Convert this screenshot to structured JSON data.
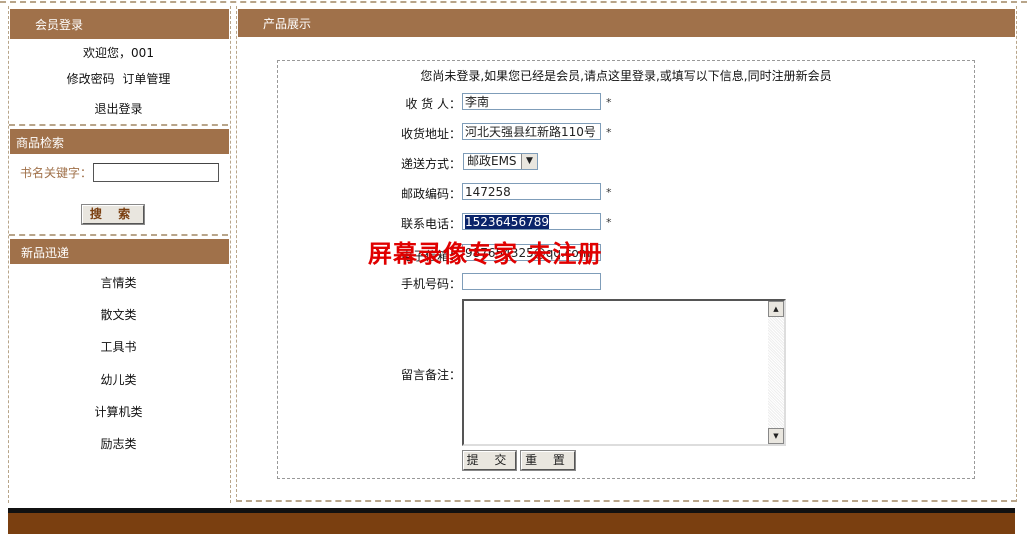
{
  "sidebar": {
    "member": {
      "header": "会员登录",
      "welcome": "欢迎您，001",
      "change_password": "修改密码",
      "orders": "订单管理",
      "logout": "退出登录"
    },
    "search": {
      "header": "商品检索",
      "keyword_label": "书名关键字：",
      "keyword_value": "",
      "button": "搜 索"
    },
    "new_books": {
      "header": "新品迅递",
      "items": [
        "言情类",
        "散文类",
        "工具书",
        "幼儿类",
        "计算机类",
        "励志类"
      ]
    }
  },
  "main": {
    "header": "产品展示",
    "notice": "您尚未登录,如果您已经是会员,请点这里登录,或填写以下信息,同时注册新会员",
    "form": {
      "receiver_label": "收 货 人：",
      "receiver_value": "李南",
      "address_label": "收货地址：",
      "address_value": "河北天强县红新路110号",
      "delivery_label": "递送方式：",
      "delivery_value": "邮政EMS",
      "postcode_label": "邮政编码：",
      "postcode_value": "147258",
      "phone_label": "联系电话：",
      "phone_value": "15236456789",
      "email_label": "电子信箱：",
      "email_value": "987654325@qq.com",
      "mobile_label": "手机号码：",
      "mobile_value": "",
      "remark_label": "留言备注：",
      "remark_value": "",
      "required_mark": "*",
      "submit": "提 交",
      "reset": "重 置"
    }
  },
  "watermark": "屏幕录像专家 未注册",
  "colors": {
    "header_bg": "#a0714a",
    "footer_bg": "#7a3f10",
    "watermark": "#e00000"
  }
}
